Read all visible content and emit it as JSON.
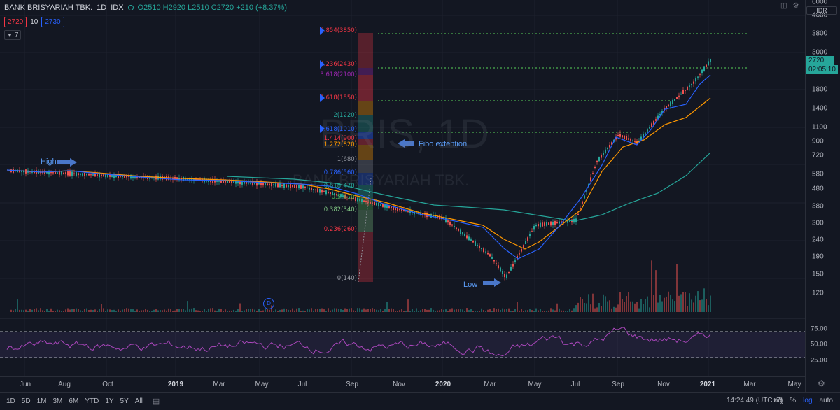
{
  "legend": {
    "title": "BANK BRISYARIAH TBK.",
    "interval": "1D",
    "exchange": "IDX",
    "ohlc_text": "O2510  H2920  L2510  C2720  +210 (+8.37%)",
    "bid": "2720",
    "qty": "10",
    "ask": "2730",
    "indicator_count": "7"
  },
  "watermark": {
    "symbol": "BRIS, 1D",
    "name": "BANK BRISYARIAH TBK."
  },
  "axis": {
    "currency": "IDR",
    "price_ticks": [
      "6000",
      "4600",
      "3800",
      "3000",
      "2400",
      "1800",
      "1400",
      "1100",
      "900",
      "720",
      "580",
      "480",
      "380",
      "300",
      "240",
      "190",
      "150",
      "120"
    ],
    "current_price": "2720",
    "timer": "02:05:10",
    "rsi_ticks": [
      "75.00",
      "50.00",
      "25.00"
    ],
    "time_ticks": [
      "Jun",
      "Aug",
      "Oct",
      "2019",
      "Mar",
      "May",
      "Jul",
      "Sep",
      "Nov",
      "2020",
      "Mar",
      "May",
      "Jul",
      "Sep",
      "Nov",
      "2021",
      "Mar",
      "May"
    ]
  },
  "fib": [
    {
      "label": "6.854(3850)",
      "color": "#f23645"
    },
    {
      "label": "4.236(2430)",
      "color": "#f23645"
    },
    {
      "label": "3.618(2100)",
      "color": "#9c27b0"
    },
    {
      "label": "2.618(1550)",
      "color": "#f23645"
    },
    {
      "label": "2(1220)",
      "color": "#26a69a"
    },
    {
      "label": "1.618(1010)",
      "color": "#2962ff"
    },
    {
      "label": "1.414(900)",
      "color": "#f23645"
    },
    {
      "label": "1.272(820)",
      "color": "#ff9800"
    },
    {
      "label": "1(680)",
      "color": "#9598a1"
    },
    {
      "label": "0.786(560)",
      "color": "#2962ff"
    },
    {
      "label": "0.618(470)",
      "color": "#26a69a"
    },
    {
      "label": "0.5(410)",
      "color": "#4caf50"
    },
    {
      "label": "0.382(340)",
      "color": "#81c784"
    },
    {
      "label": "0.236(260)",
      "color": "#f23645"
    },
    {
      "label": "0(140)",
      "color": "#9598a1"
    }
  ],
  "notes": {
    "high": "High",
    "low": "Low",
    "fibo": "Fibo extention"
  },
  "dividend_marker": "D",
  "toolbar": {
    "ranges": [
      "1D",
      "5D",
      "1M",
      "3M",
      "6M",
      "YTD",
      "1Y",
      "5Y",
      "All"
    ],
    "clock": "14:24:49 (UTC+7)",
    "percent": "%",
    "log": "log",
    "auto": "auto",
    "adj": "adj"
  },
  "chart_data": {
    "type": "line",
    "title": "BANK BRISYARIAH TBK.",
    "scale": "log",
    "x": [
      "2018-06",
      "2018-08",
      "2018-10",
      "2019-01",
      "2019-03",
      "2019-05",
      "2019-07",
      "2019-09",
      "2019-11",
      "2020-01",
      "2020-03",
      "2020-04",
      "2020-05",
      "2020-07",
      "2020-08",
      "2020-09",
      "2020-10",
      "2020-11",
      "2020-12",
      "2021-01"
    ],
    "series": [
      {
        "values": [
          620,
          600,
          580,
          560,
          540,
          520,
          500,
          430,
          370,
          330,
          200,
          150,
          300,
          320,
          700,
          1000,
          900,
          1400,
          2000,
          2720
        ]
      }
    ],
    "ylim": [
      110,
      6000
    ],
    "rsi_levels": [
      30,
      70
    ]
  }
}
